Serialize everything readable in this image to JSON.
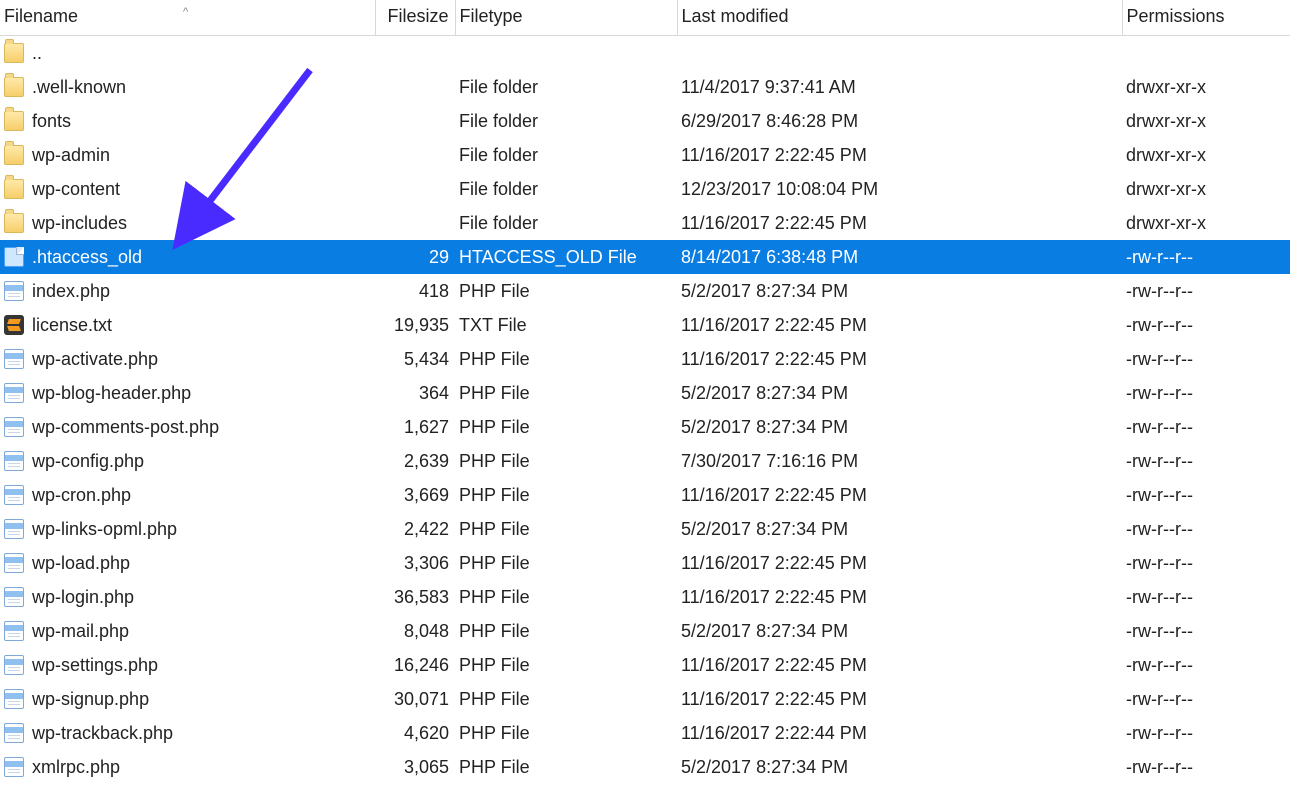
{
  "columns": {
    "filename": "Filename",
    "filesize": "Filesize",
    "filetype": "Filetype",
    "last_modified": "Last modified",
    "permissions": "Permissions"
  },
  "selected_index": 6,
  "arrow_color": "#4a2bff",
  "rows": [
    {
      "icon": "folder",
      "name": "..",
      "size": "",
      "type": "",
      "modified": "",
      "perm": ""
    },
    {
      "icon": "folder",
      "name": ".well-known",
      "size": "",
      "type": "File folder",
      "modified": "11/4/2017 9:37:41 AM",
      "perm": "drwxr-xr-x"
    },
    {
      "icon": "folder",
      "name": "fonts",
      "size": "",
      "type": "File folder",
      "modified": "6/29/2017 8:46:28 PM",
      "perm": "drwxr-xr-x"
    },
    {
      "icon": "folder",
      "name": "wp-admin",
      "size": "",
      "type": "File folder",
      "modified": "11/16/2017 2:22:45 PM",
      "perm": "drwxr-xr-x"
    },
    {
      "icon": "folder",
      "name": "wp-content",
      "size": "",
      "type": "File folder",
      "modified": "12/23/2017 10:08:04 PM",
      "perm": "drwxr-xr-x"
    },
    {
      "icon": "folder",
      "name": "wp-includes",
      "size": "",
      "type": "File folder",
      "modified": "11/16/2017 2:22:45 PM",
      "perm": "drwxr-xr-x"
    },
    {
      "icon": "file",
      "name": ".htaccess_old",
      "size": "29",
      "type": "HTACCESS_OLD File",
      "modified": "8/14/2017 6:38:48 PM",
      "perm": "-rw-r--r--"
    },
    {
      "icon": "php",
      "name": "index.php",
      "size": "418",
      "type": "PHP File",
      "modified": "5/2/2017 8:27:34 PM",
      "perm": "-rw-r--r--"
    },
    {
      "icon": "txt",
      "name": "license.txt",
      "size": "19,935",
      "type": "TXT File",
      "modified": "11/16/2017 2:22:45 PM",
      "perm": "-rw-r--r--"
    },
    {
      "icon": "php",
      "name": "wp-activate.php",
      "size": "5,434",
      "type": "PHP File",
      "modified": "11/16/2017 2:22:45 PM",
      "perm": "-rw-r--r--"
    },
    {
      "icon": "php",
      "name": "wp-blog-header.php",
      "size": "364",
      "type": "PHP File",
      "modified": "5/2/2017 8:27:34 PM",
      "perm": "-rw-r--r--"
    },
    {
      "icon": "php",
      "name": "wp-comments-post.php",
      "size": "1,627",
      "type": "PHP File",
      "modified": "5/2/2017 8:27:34 PM",
      "perm": "-rw-r--r--"
    },
    {
      "icon": "php",
      "name": "wp-config.php",
      "size": "2,639",
      "type": "PHP File",
      "modified": "7/30/2017 7:16:16 PM",
      "perm": "-rw-r--r--"
    },
    {
      "icon": "php",
      "name": "wp-cron.php",
      "size": "3,669",
      "type": "PHP File",
      "modified": "11/16/2017 2:22:45 PM",
      "perm": "-rw-r--r--"
    },
    {
      "icon": "php",
      "name": "wp-links-opml.php",
      "size": "2,422",
      "type": "PHP File",
      "modified": "5/2/2017 8:27:34 PM",
      "perm": "-rw-r--r--"
    },
    {
      "icon": "php",
      "name": "wp-load.php",
      "size": "3,306",
      "type": "PHP File",
      "modified": "11/16/2017 2:22:45 PM",
      "perm": "-rw-r--r--"
    },
    {
      "icon": "php",
      "name": "wp-login.php",
      "size": "36,583",
      "type": "PHP File",
      "modified": "11/16/2017 2:22:45 PM",
      "perm": "-rw-r--r--"
    },
    {
      "icon": "php",
      "name": "wp-mail.php",
      "size": "8,048",
      "type": "PHP File",
      "modified": "5/2/2017 8:27:34 PM",
      "perm": "-rw-r--r--"
    },
    {
      "icon": "php",
      "name": "wp-settings.php",
      "size": "16,246",
      "type": "PHP File",
      "modified": "11/16/2017 2:22:45 PM",
      "perm": "-rw-r--r--"
    },
    {
      "icon": "php",
      "name": "wp-signup.php",
      "size": "30,071",
      "type": "PHP File",
      "modified": "11/16/2017 2:22:45 PM",
      "perm": "-rw-r--r--"
    },
    {
      "icon": "php",
      "name": "wp-trackback.php",
      "size": "4,620",
      "type": "PHP File",
      "modified": "11/16/2017 2:22:44 PM",
      "perm": "-rw-r--r--"
    },
    {
      "icon": "php",
      "name": "xmlrpc.php",
      "size": "3,065",
      "type": "PHP File",
      "modified": "5/2/2017 8:27:34 PM",
      "perm": "-rw-r--r--"
    }
  ]
}
